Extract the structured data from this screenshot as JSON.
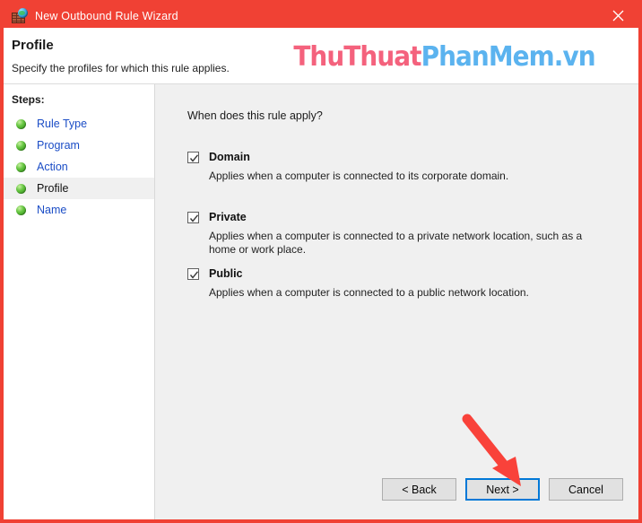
{
  "window": {
    "title": "New Outbound Rule Wizard",
    "title_icon": "firewall-globe-icon",
    "close_label": "×",
    "border_color": "#f04134",
    "titlebar_color": "#f04134"
  },
  "header": {
    "title": "Profile",
    "subtitle": "Specify the profiles for which this rule applies.",
    "watermark_part1": "ThuThuat",
    "watermark_part2": "PhanMem.vn",
    "watermark_color1": "#f4627d",
    "watermark_color2": "#5bb3ef"
  },
  "sidebar": {
    "label": "Steps:",
    "items": [
      {
        "label": "Rule Type",
        "current": false
      },
      {
        "label": "Program",
        "current": false
      },
      {
        "label": "Action",
        "current": false
      },
      {
        "label": "Profile",
        "current": true
      },
      {
        "label": "Name",
        "current": false
      }
    ],
    "link_color": "#1b4dc6",
    "current_color": "#111111"
  },
  "main": {
    "question": "When does this rule apply?",
    "options": [
      {
        "name": "Domain",
        "checked": true,
        "description": "Applies when a computer is connected to its corporate domain."
      },
      {
        "name": "Private",
        "checked": true,
        "description": "Applies when a computer is connected to a private network location, such as a home or work place."
      },
      {
        "name": "Public",
        "checked": true,
        "description": "Applies when a computer is connected to a public network location."
      }
    ]
  },
  "footer": {
    "buttons": [
      {
        "label": "< Back",
        "default": false
      },
      {
        "label": "Next >",
        "default": true
      },
      {
        "label": "Cancel",
        "default": false
      }
    ],
    "focus_color": "#0078d7"
  },
  "annotation": {
    "arrow_color": "#f9423a",
    "arrow_target": "next-button"
  }
}
